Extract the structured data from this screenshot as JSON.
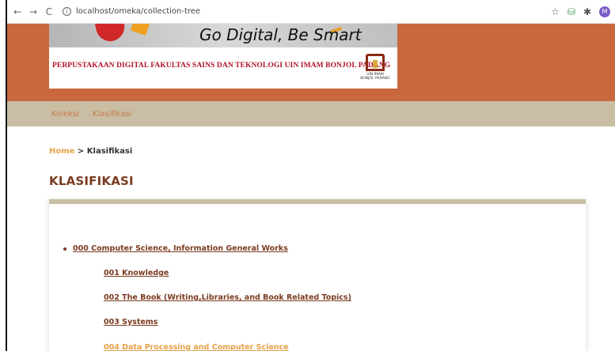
{
  "browser": {
    "url": "localhost/omeka/collection-tree",
    "back": "←",
    "forward": "→",
    "reload": "C",
    "info": "i",
    "bookmark": "☆",
    "ext1": "⛁",
    "ext2": "✱",
    "avatar": "M"
  },
  "banner": {
    "tagline": "Go Digital, Be Smart",
    "library_name": "PERPUSTAKAAN DIGITAL FAKULTAS SAINS DAN TEKNOLOGI UIN IMAM BONJOL PADANG",
    "logo_caption": "UIN IMAM BONJOL PADANG"
  },
  "menu": {
    "items": [
      "Koleksi",
      "Klasifikasi"
    ]
  },
  "breadcrumb": {
    "home": "Home",
    "separator": " > ",
    "current": "Klasifikasi"
  },
  "page": {
    "title": "KLASIFIKASI"
  },
  "tree": {
    "root": "000 Computer Science, Information General Works",
    "children": [
      "001 Knowledge",
      "002 The Book (Writing,Libraries, and Book Related Topics)",
      "003 Systems",
      "004 Data Processing and Computer Science"
    ]
  },
  "colors": {
    "header": "#c9683e",
    "menu_bar": "#c9bea4",
    "title": "#7a3b20",
    "link_hover": "#e6a24a"
  }
}
